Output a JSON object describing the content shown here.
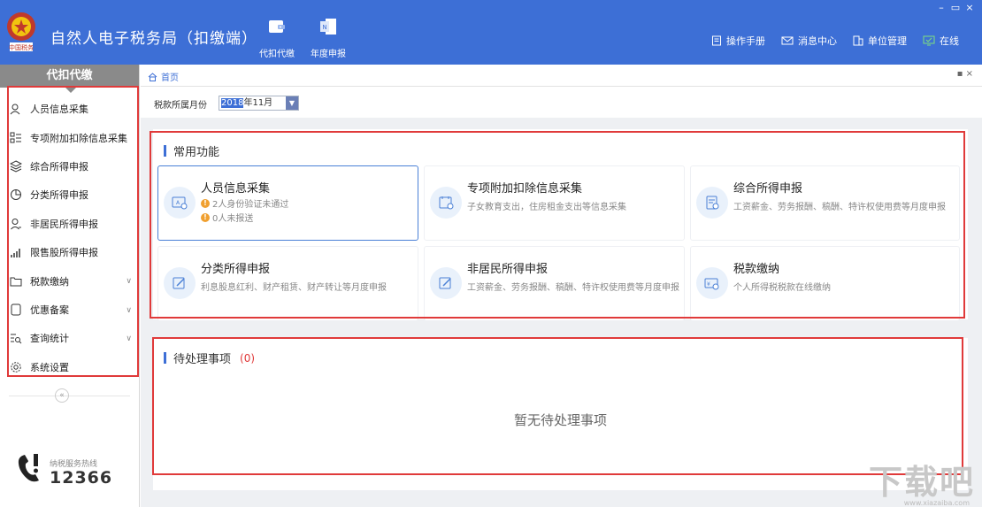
{
  "app": {
    "title": "自然人电子税务局（扣缴端）"
  },
  "window_controls": {
    "minimize": "–",
    "restore": "▭",
    "close": "×"
  },
  "top_nav": [
    {
      "label": "代扣代缴",
      "icon": "wallet-icon"
    },
    {
      "label": "年度申报",
      "icon": "report-icon"
    }
  ],
  "header_links": [
    {
      "label": "操作手册",
      "icon": "manual-icon"
    },
    {
      "label": "消息中心",
      "icon": "mail-icon"
    },
    {
      "label": "单位管理",
      "icon": "building-icon"
    },
    {
      "label": "在线",
      "icon": "online-icon"
    }
  ],
  "sidebar": {
    "title": "代扣代缴",
    "items": [
      {
        "label": "人员信息采集",
        "icon": "person-icon",
        "expandable": false
      },
      {
        "label": "专项附加扣除信息采集",
        "icon": "list-icon",
        "expandable": false
      },
      {
        "label": "综合所得申报",
        "icon": "layers-icon",
        "expandable": false
      },
      {
        "label": "分类所得申报",
        "icon": "pie-icon",
        "expandable": false
      },
      {
        "label": "非居民所得申报",
        "icon": "user-outline-icon",
        "expandable": false
      },
      {
        "label": "限售股所得申报",
        "icon": "bar-chart-icon",
        "expandable": false
      },
      {
        "label": "税款缴纳",
        "icon": "folder-icon",
        "expandable": true
      },
      {
        "label": "优惠备案",
        "icon": "document-icon",
        "expandable": true
      },
      {
        "label": "查询统计",
        "icon": "query-icon",
        "expandable": true
      },
      {
        "label": "系统设置",
        "icon": "gear-icon",
        "expandable": false
      }
    ],
    "collapse_label": "«",
    "hotline_label": "纳税服务热线",
    "hotline_number": "12366"
  },
  "tabs": {
    "home": "首页",
    "tab_controls": "▪ ×"
  },
  "filter": {
    "label": "税款所属月份",
    "year": "2018",
    "month": "年11月",
    "dropdown": "▼"
  },
  "common_functions": {
    "title": "常用功能",
    "cards": [
      {
        "title": "人员信息采集",
        "warnings": [
          "2人身份验证未通过",
          "0人未报送"
        ],
        "desc": ""
      },
      {
        "title": "专项附加扣除信息采集",
        "warnings": [],
        "desc": "子女教育支出，住房租金支出等信息采集"
      },
      {
        "title": "综合所得申报",
        "warnings": [],
        "desc": "工资薪金、劳务报酬、稿酬、特许权使用费等月度申报"
      },
      {
        "title": "分类所得申报",
        "warnings": [],
        "desc": "利息股息红利、财产租赁、财产转让等月度申报"
      },
      {
        "title": "非居民所得申报",
        "warnings": [],
        "desc": "工资薪金、劳务报酬、稿酬、特许权使用费等月度申报"
      },
      {
        "title": "税款缴纳",
        "warnings": [],
        "desc": "个人所得税税款在线缴纳"
      }
    ]
  },
  "pending": {
    "title": "待处理事项",
    "count": "(0)",
    "empty_message": "暂无待处理事项"
  },
  "watermark": {
    "main": "下载吧",
    "sub": "www.xiazaiba.com"
  },
  "colors": {
    "brand": "#3d6fd6",
    "highlight": "#e03a3a",
    "warning": "#f0a030"
  }
}
